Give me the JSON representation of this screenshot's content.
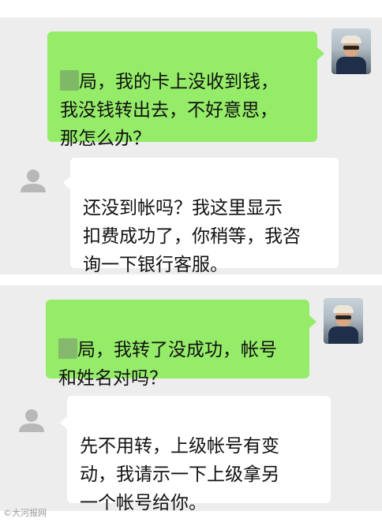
{
  "conversation_1": {
    "sent": {
      "redacted_prefix": "",
      "text": "局，我的卡上没收到钱，\n我没钱转出去，不好意思，\n那怎么办？"
    },
    "received": {
      "text": "还没到帐吗？我这里显示\n扣费成功了，你稍等，我咨\n询一下银行客服。"
    }
  },
  "conversation_2": {
    "sent": {
      "redacted_prefix": "",
      "text": "局，我转了没成功，帐号\n和姓名对吗？"
    },
    "received": {
      "text": "先不用转，上级帐号有变\n动，我请示一下上级拿另\n一个帐号给你。"
    }
  },
  "watermark": "©大河报网",
  "colors": {
    "sent_bubble": "#95ec69",
    "received_bubble": "#ffffff",
    "panel_background": "#ededed"
  },
  "icons": {
    "sender_avatar": "person-photo",
    "receiver_avatar": "default-person-icon"
  }
}
